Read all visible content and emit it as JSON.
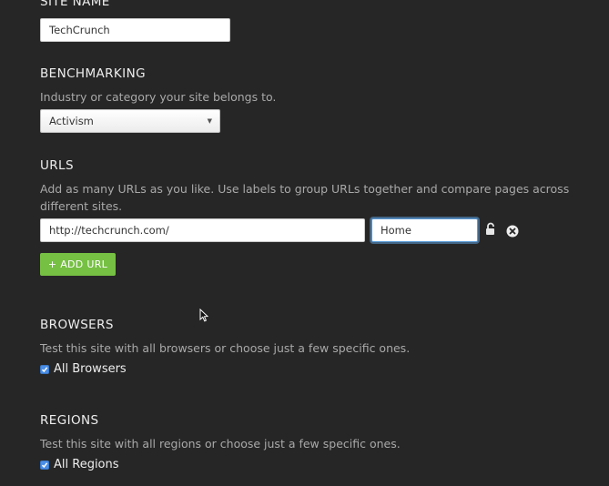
{
  "site_name": {
    "title": "SITE NAME",
    "value": "TechCrunch"
  },
  "benchmarking": {
    "title": "BENCHMARKING",
    "description": "Industry or category your site belongs to.",
    "selected": "Activism"
  },
  "urls": {
    "title": "URLS",
    "description_line1": "Add as many URLs as you like. Use labels to group URLs together and compare pages across",
    "description_line2": "different sites.",
    "url_value": "http://techcrunch.com/",
    "label_value": "Home",
    "add_button": "+ ADD URL"
  },
  "browsers": {
    "title": "BROWSERS",
    "description": "Test this site with all browsers or choose just a few specific ones.",
    "checkbox_label": "All Browsers",
    "checked": true
  },
  "regions": {
    "title": "REGIONS",
    "description": "Test this site with all regions or choose just a few specific ones.",
    "checkbox_label": "All Regions",
    "checked": true
  },
  "icons": {
    "lock": "unlock-icon",
    "remove": "close-circle-icon",
    "cursor": "mouse-pointer-icon",
    "dropdown": "chevron-down-icon",
    "check": "check-icon"
  },
  "colors": {
    "background": "#262626",
    "accent_green": "#76c043",
    "checkbox_blue": "#4a8ee6",
    "focus_blue": "#5b9dd9"
  }
}
